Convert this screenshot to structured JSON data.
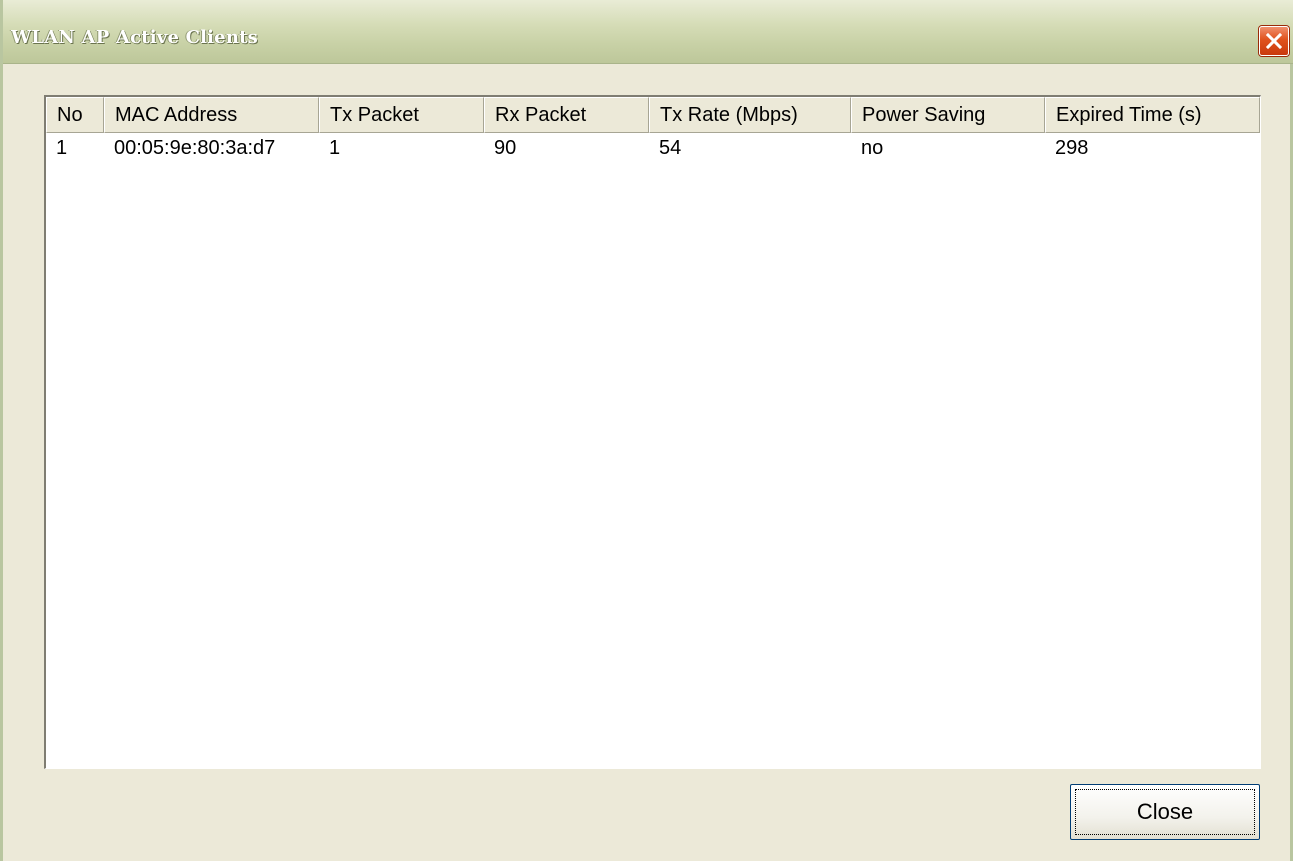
{
  "window": {
    "title": "WLAN AP Active Clients",
    "close_icon": "close-x-icon"
  },
  "table": {
    "columns": [
      "No",
      "MAC Address",
      "Tx Packet",
      "Rx Packet",
      "Tx Rate (Mbps)",
      "Power Saving",
      "Expired Time (s)"
    ],
    "rows": [
      [
        "1",
        "00:05:9e:80:3a:d7",
        "1",
        "90",
        "54",
        "no",
        "298"
      ]
    ]
  },
  "footer": {
    "close_label": "Close"
  },
  "colors": {
    "dialog_background": "#ece9d8",
    "title_text": "#ffffff",
    "close_icon_red": "#e0521d",
    "list_background": "#ffffff"
  }
}
